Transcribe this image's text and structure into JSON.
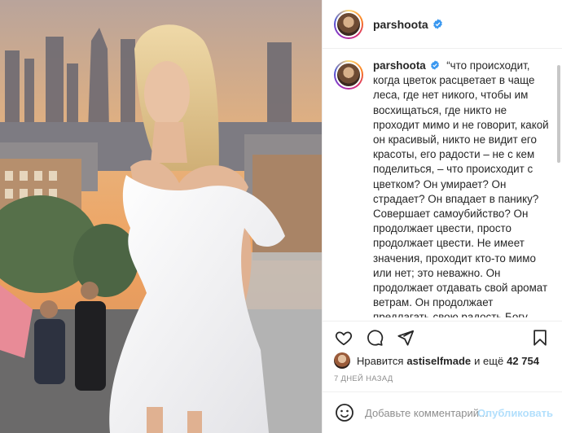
{
  "post": {
    "author": "parshoota",
    "caption": "“что происходит, когда цветок расцветает в чаще леса, где нет никого, чтобы им восхищаться, где никто не проходит мимо и не говорит, какой он красивый, никто не видит его красоты, его радости – не с кем поделиться, – что происходит с цветком? Он умирает? Он страдает? Он впадает в панику? Совершает самоубийство? Он продолжает цвести, просто продолжает цвести. Не имеет значения, проходит кто-то мимо или нет; это неважно. Он продолжает отдавать свой аромат ветрам. Он продолжает предлагать свою радость Богу, целому. Если я один, то и тогда я буду таким же любящим, каким был с тобой. Это",
    "likes": {
      "prefix": "Нравится",
      "user": "astiselfmade",
      "conjunction": "и ещё",
      "count": "42 754"
    },
    "time_ago": "7 дней назад"
  },
  "comment": {
    "placeholder": "Добавьте комментарий...",
    "post_label": "Опубликовать"
  },
  "icons": {
    "like": "heart-icon",
    "comment": "comment-icon",
    "share": "paper-plane-icon",
    "save": "bookmark-icon",
    "emoji": "smiley-icon",
    "verified": "verified-badge-icon"
  },
  "colors": {
    "verified": "#3897f0",
    "text": "#262626",
    "muted": "#8e8e8e",
    "border": "#efefef"
  }
}
